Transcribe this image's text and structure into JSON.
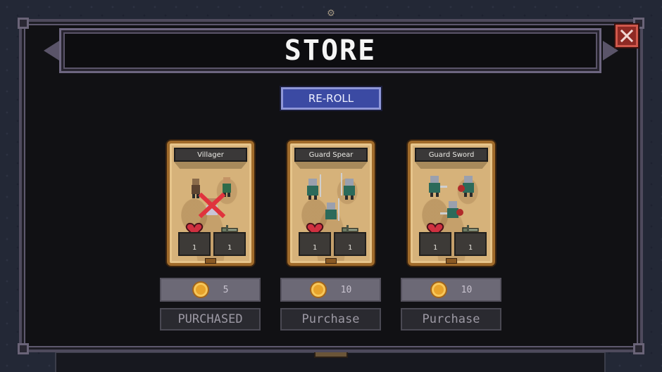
{
  "title": "STORE",
  "reroll_label": "RE-ROLL",
  "close_label": "X",
  "cards": [
    {
      "name": "Villager",
      "health": "1",
      "attack": "1",
      "price": "5",
      "button": "PURCHASED",
      "purchased": true
    },
    {
      "name": "Guard Spear",
      "health": "1",
      "attack": "1",
      "price": "10",
      "button": "Purchase",
      "purchased": false
    },
    {
      "name": "Guard Sword",
      "health": "1",
      "attack": "1",
      "price": "10",
      "button": "Purchase",
      "purchased": false
    }
  ],
  "colors": {
    "frame": "#4e4a5c",
    "card_border": "#a06b2b",
    "card_bg": "#d6b27a",
    "reroll": "#3b4aa3",
    "close": "#8e2a24",
    "coin": "#e8a32b"
  },
  "icons": [
    "gear-icon",
    "close-icon",
    "heart-icon",
    "sword-icon",
    "coin-icon",
    "crossed-out-icon"
  ]
}
